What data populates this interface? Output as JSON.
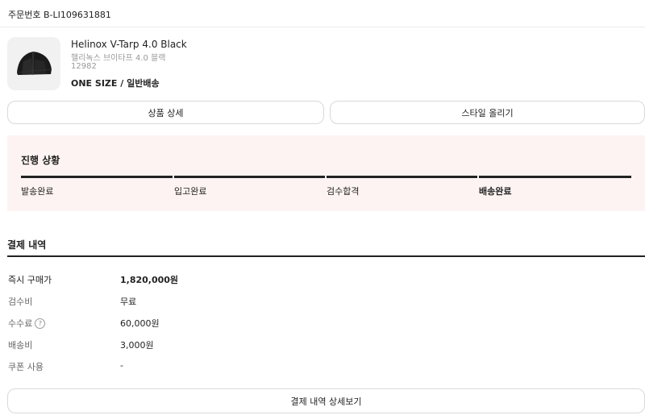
{
  "order": {
    "number": "주문번호 B-LI109631881"
  },
  "product": {
    "name_en": "Helinox V-Tarp 4.0 Black",
    "name_ko": "헬리녹스 브이타프 4.0 블랙",
    "model": "12982",
    "option": "ONE SIZE / 일반배송"
  },
  "actions": {
    "detail": "상품 상세",
    "style": "스타일 올리기"
  },
  "progress": {
    "title": "진행 상황",
    "steps": [
      "발송완료",
      "입고완료",
      "검수합격",
      "배송완료"
    ]
  },
  "payment": {
    "title": "결제 내역",
    "rows": [
      {
        "label": "즉시 구매가",
        "value": "1,820,000원"
      },
      {
        "label": "검수비",
        "value": "무료"
      },
      {
        "label": "수수료",
        "value": "60,000원"
      },
      {
        "label": "배송비",
        "value": "3,000원"
      },
      {
        "label": "쿠폰 사용",
        "value": "-"
      }
    ],
    "help_icon": "?",
    "detail_button": "결제 내역 상세보기"
  }
}
